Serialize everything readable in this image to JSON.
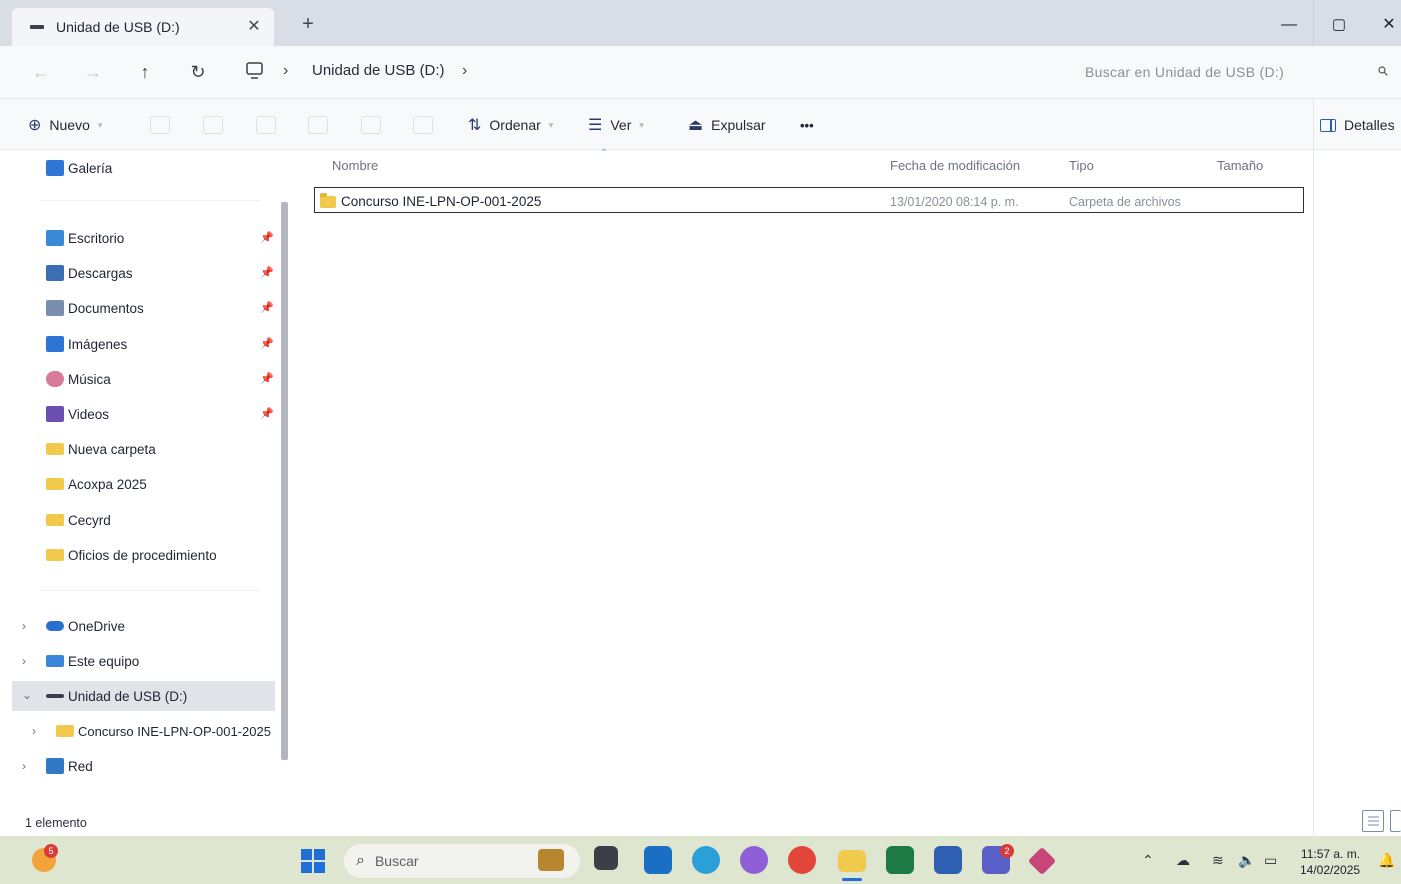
{
  "window": {
    "tab_title": "Unidad de USB (D:)",
    "tab_close": "✕",
    "new_tab": "+",
    "minimize": "—",
    "restore": "▢",
    "close": "✕"
  },
  "address": {
    "back": "←",
    "forward": "→",
    "up": "↑",
    "refresh": "↻",
    "crumb_sep": "›",
    "crumb_current": "Unidad de USB (D:)",
    "search_placeholder": "Buscar en Unidad de USB (D:)"
  },
  "toolbar": {
    "new_label": "Nuevo",
    "sort_label": "Ordenar",
    "view_label": "Ver",
    "eject_label": "Expulsar",
    "more_label": "•••",
    "details_label": "Detalles"
  },
  "nav": {
    "gallery": "Galería",
    "quick_access": [
      {
        "label": "Escritorio",
        "icon": "desktop-icon",
        "color": "#3b8ad8"
      },
      {
        "label": "Descargas",
        "icon": "download-icon",
        "color": "#3b6fb5"
      },
      {
        "label": "Documentos",
        "icon": "document-icon",
        "color": "#7a8fb0"
      },
      {
        "label": "Imágenes",
        "icon": "pictures-icon",
        "color": "#2e74d6"
      },
      {
        "label": "Música",
        "icon": "music-icon",
        "color": "#d87a9a"
      },
      {
        "label": "Videos",
        "icon": "video-icon",
        "color": "#6a4fb0"
      },
      {
        "label": "Nueva carpeta",
        "icon": "folder-icon",
        "color": "#f0c94d"
      },
      {
        "label": "Acoxpa 2025",
        "icon": "folder-icon",
        "color": "#f0c94d"
      },
      {
        "label": "Cecyrd",
        "icon": "folder-icon",
        "color": "#f0c94d"
      },
      {
        "label": "Oficios de procedimiento",
        "icon": "folder-icon",
        "color": "#f0c94d"
      }
    ],
    "onedrive": "OneDrive",
    "this_pc": "Este equipo",
    "usb": "Unidad de USB (D:)",
    "usb_child": "Concurso INE-LPN-OP-001-2025",
    "network": "Red"
  },
  "list": {
    "headers": {
      "name": "Nombre",
      "date": "Fecha de modificación",
      "type": "Tipo",
      "size": "Tamaño"
    },
    "rows": [
      {
        "name": "Concurso INE-LPN-OP-001-2025",
        "date": "13/01/2020 08:14 p. m.",
        "type": "Carpeta de archivos",
        "size": ""
      }
    ]
  },
  "status": {
    "count": "1 elemento"
  },
  "taskbar": {
    "search_placeholder": "Buscar",
    "weather_badge": "5",
    "teams_badge": "2",
    "time": "11:57 a. m.",
    "date": "14/02/2025"
  }
}
